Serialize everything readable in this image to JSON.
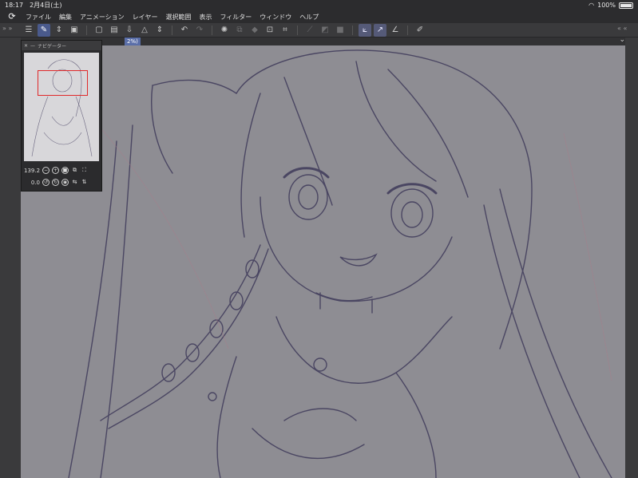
{
  "status": {
    "time": "18:17",
    "date": "2月4日(土)",
    "battery": "100%"
  },
  "menu": {
    "items": [
      "ファイル",
      "編集",
      "アニメーション",
      "レイヤー",
      "選択範囲",
      "表示",
      "フィルター",
      "ウィンドウ",
      "ヘルプ"
    ]
  },
  "navigator": {
    "title": "ナビゲーター",
    "zoom": "139.2",
    "rotation": "0.0"
  },
  "tab": {
    "label": "2%)"
  },
  "colors": {
    "accent": "#4a5a8c",
    "nav_rect": "#e0282a",
    "canvas": "#8e8d93",
    "line": "#3f3a5a"
  }
}
